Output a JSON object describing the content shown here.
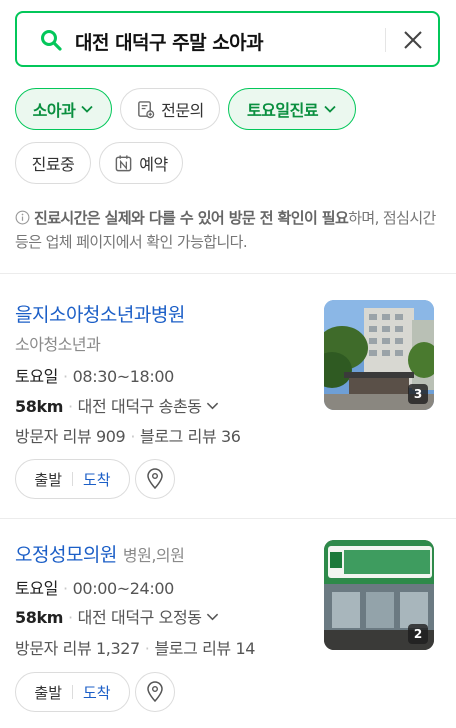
{
  "search": {
    "query": "대전 대덕구 주말 소아과"
  },
  "filters": [
    {
      "label": "소아과",
      "active": true
    },
    {
      "label": "전문의",
      "active": false
    },
    {
      "label": "토요일진료",
      "active": true
    },
    {
      "label": "진료중",
      "active": false
    },
    {
      "label": "예약",
      "active": false
    }
  ],
  "notice": {
    "bold": "진료시간은 실제와 다를 수 있어 방문 전 확인이 필요",
    "rest": "하며, 점심시간 등은 업체 페이지에서 확인 가능합니다."
  },
  "results": [
    {
      "name": "을지소아청소년과병원",
      "category": "소아청소년과",
      "day": "토요일",
      "hours": "08:30~18:00",
      "distance": "58km",
      "address": "대전 대덕구 송촌동",
      "visitor_reviews": "방문자 리뷰 909",
      "blog_reviews": "블로그 리뷰 36",
      "photo_count": "3"
    },
    {
      "name": "오정성모의원",
      "category": "병원,의원",
      "day": "토요일",
      "hours": "00:00~24:00",
      "distance": "58km",
      "address": "대전 대덕구 오정동",
      "visitor_reviews": "방문자 리뷰 1,327",
      "blog_reviews": "블로그 리뷰 14",
      "photo_count": "2"
    }
  ],
  "actions": {
    "start": "출발",
    "arrive": "도착"
  },
  "colors": {
    "accent": "#03c75a",
    "link": "#1c5fc7",
    "chip_active_bg": "#ebf8ef"
  }
}
